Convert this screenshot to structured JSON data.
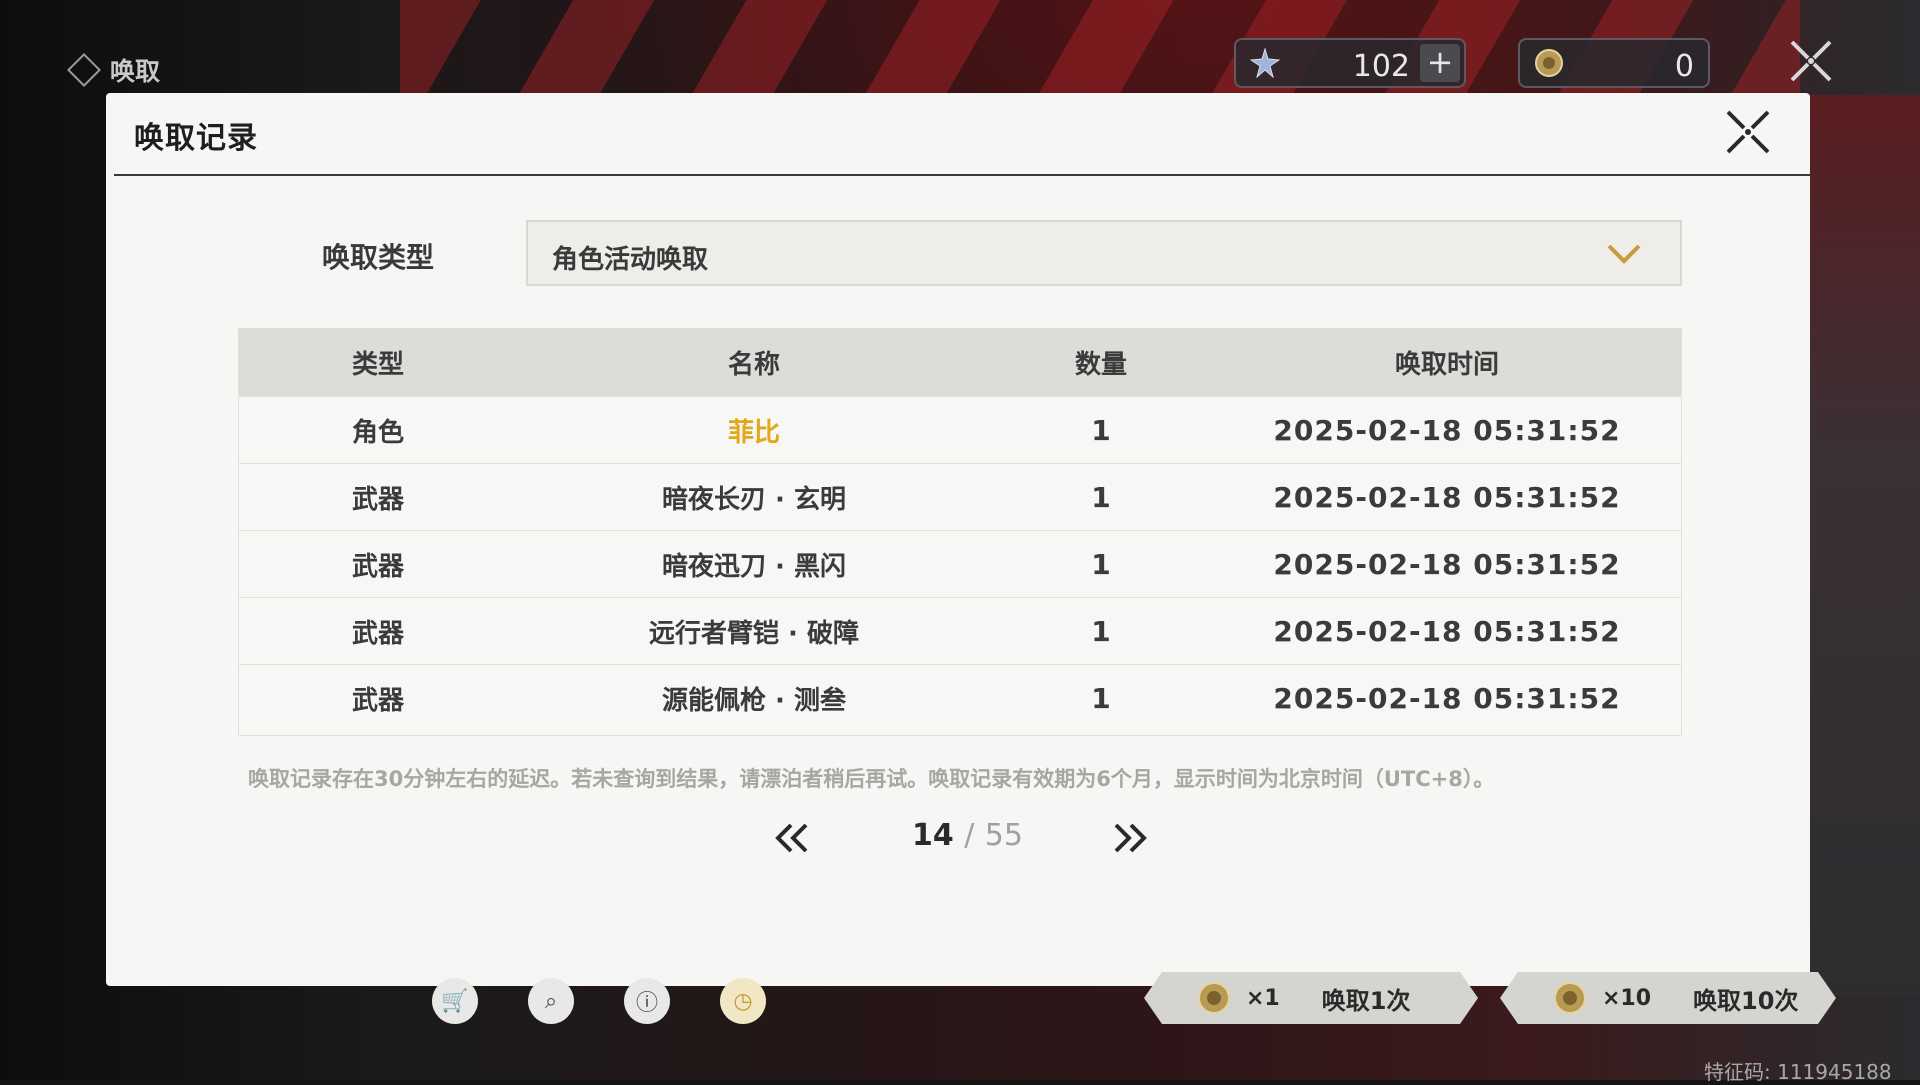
{
  "header": {
    "section_title": "唤取",
    "star_currency": {
      "value": "102",
      "plus_label": "+"
    },
    "coin_currency": {
      "value": "0"
    }
  },
  "modal": {
    "title": "唤取记录",
    "type_label": "唤取类型",
    "type_selected": "角色活动唤取",
    "table": {
      "headers": [
        "类型",
        "名称",
        "数量",
        "唤取时间"
      ],
      "rows": [
        {
          "type": "角色",
          "name": "菲比",
          "count": "1",
          "time": "2025-02-18 05:31:52",
          "highlight": true
        },
        {
          "type": "武器",
          "name": "暗夜长刃 · 玄明",
          "count": "1",
          "time": "2025-02-18 05:31:52"
        },
        {
          "type": "武器",
          "name": "暗夜迅刀 · 黑闪",
          "count": "1",
          "time": "2025-02-18 05:31:52"
        },
        {
          "type": "武器",
          "name": "远行者臂铠 · 破障",
          "count": "1",
          "time": "2025-02-18 05:31:52"
        },
        {
          "type": "武器",
          "name": "源能佩枪 · 测叁",
          "count": "1",
          "time": "2025-02-18 05:31:52"
        }
      ]
    },
    "footnote": "唤取记录存在30分钟左右的延迟。若未查询到结果，请漂泊者稍后再试。唤取记录有效期为6个月，显示时间为北京时间（UTC+8）。",
    "pagination": {
      "current": "14",
      "separator": "/",
      "total": "55"
    }
  },
  "bottom_bar": {
    "pull_one": {
      "multiplier": "×1",
      "label": "唤取1次"
    },
    "pull_ten": {
      "multiplier": "×10",
      "label": "唤取10次"
    },
    "icons": [
      "cart-icon",
      "search-record-icon",
      "info-icon",
      "clock-icon"
    ]
  },
  "feature_code": "特征码: 111945188",
  "colors": {
    "highlight": "#e0a81a",
    "modal_bg": "#f6f6f4",
    "header_row_bg": "#dcdcd9"
  }
}
